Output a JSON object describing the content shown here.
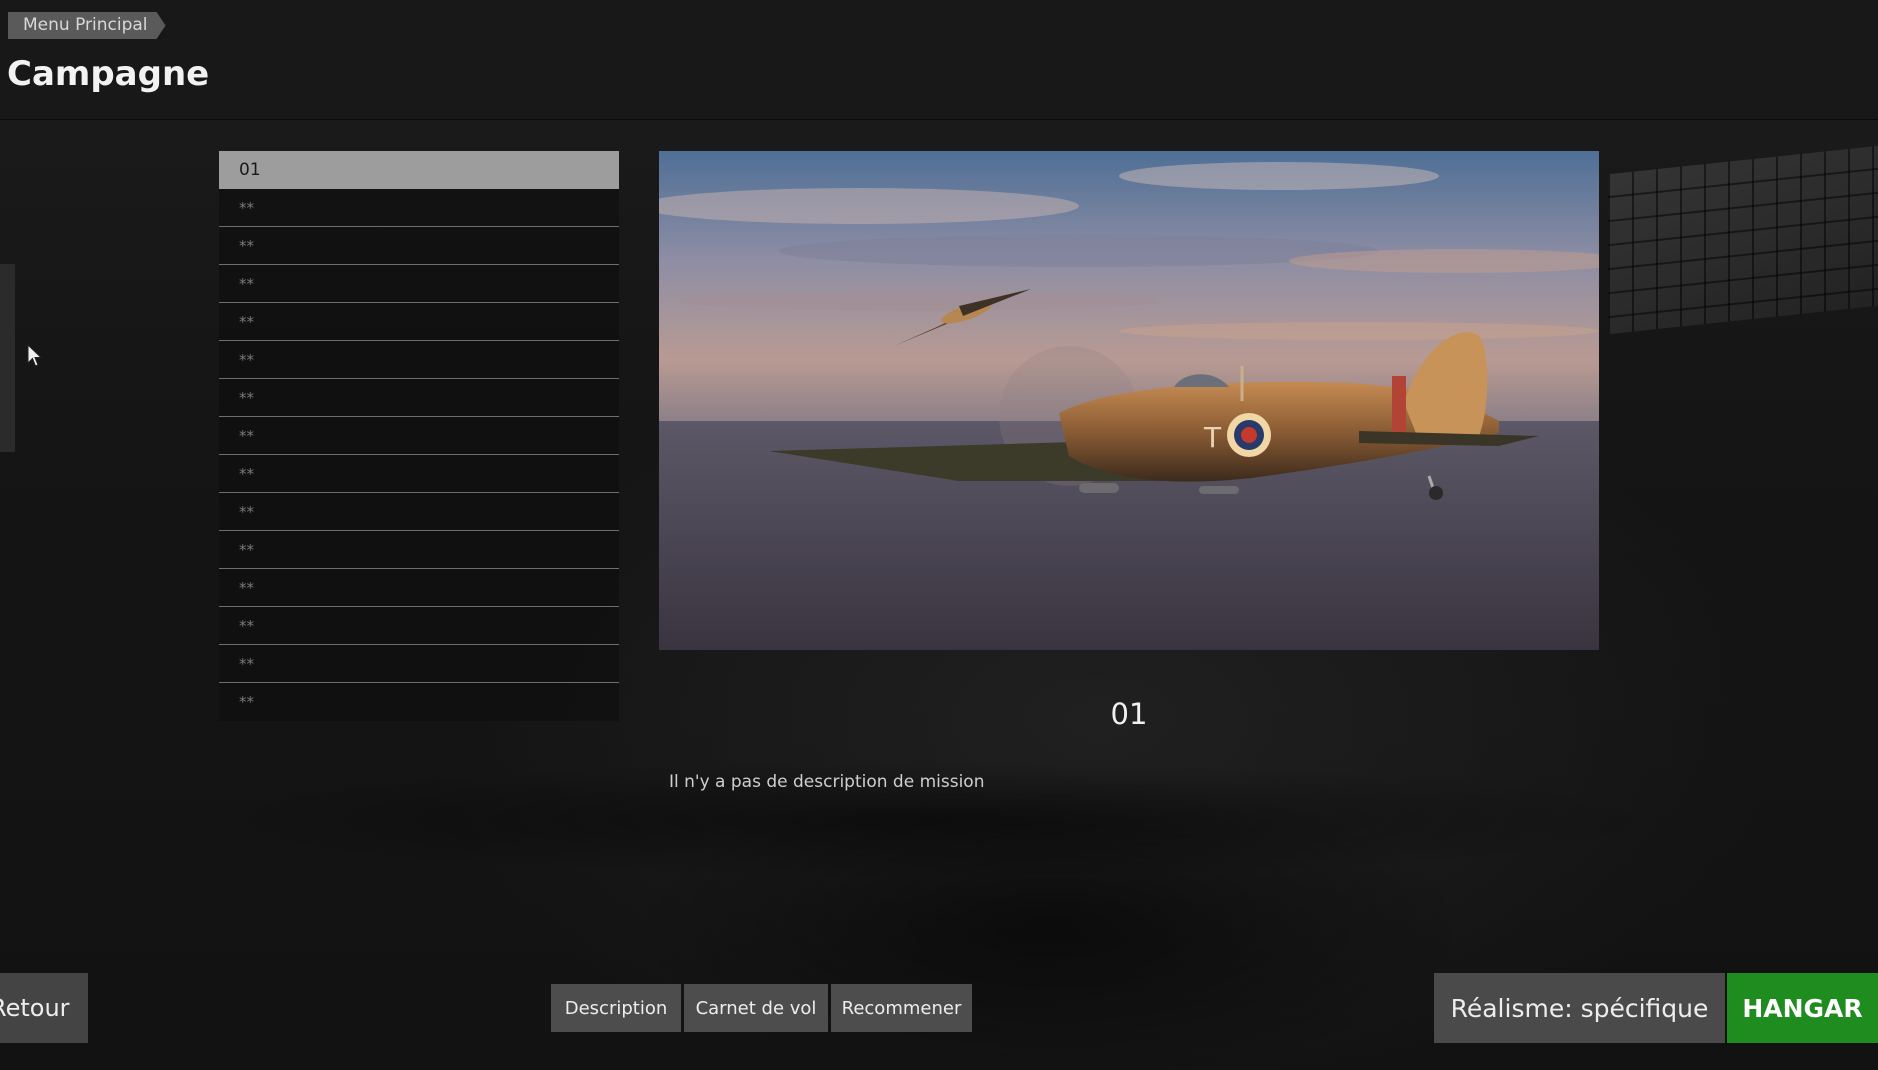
{
  "header": {
    "breadcrumb": "Menu Principal",
    "title": "Campagne"
  },
  "missions": [
    {
      "label": "01",
      "selected": true
    },
    {
      "label": "**"
    },
    {
      "label": "**"
    },
    {
      "label": "**"
    },
    {
      "label": "**"
    },
    {
      "label": "**"
    },
    {
      "label": "**"
    },
    {
      "label": "**"
    },
    {
      "label": "**"
    },
    {
      "label": "**"
    },
    {
      "label": "**"
    },
    {
      "label": "**"
    },
    {
      "label": "**"
    },
    {
      "label": "**"
    },
    {
      "label": "**"
    }
  ],
  "detail": {
    "name": "01",
    "description": "Il n'y a pas de description de mission"
  },
  "bottom": {
    "back_label": "Retour",
    "tabs": [
      "Description",
      "Carnet de vol",
      "Recommener"
    ],
    "realism_label": "Réalisme: spécifique",
    "hangar_label": "HANGAR"
  },
  "colors": {
    "accent": "#1e8c1e",
    "selected_row": "#9d9d9d",
    "button": "#4d4d4d"
  },
  "icons": [
    "cursor-icon"
  ]
}
